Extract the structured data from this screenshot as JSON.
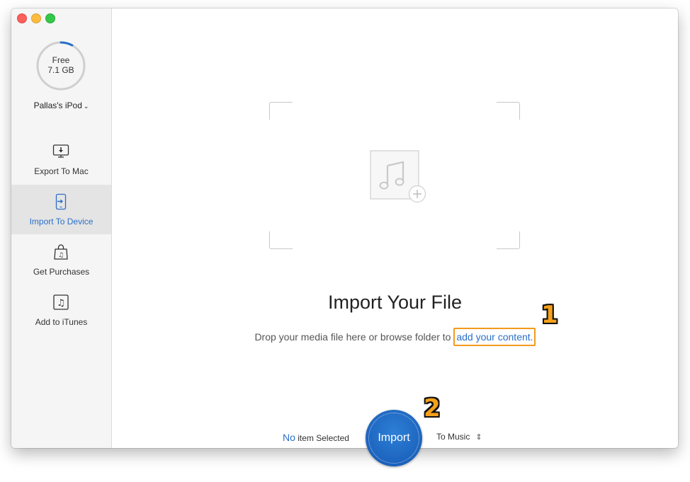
{
  "window": {
    "controls": [
      "close",
      "minimize",
      "maximize"
    ]
  },
  "sidebar": {
    "storage": {
      "label": "Free",
      "value": "7.1 GB",
      "used_fraction": 0.08
    },
    "device_name": "Pallas's iPod",
    "items": [
      {
        "label": "Export To Mac",
        "icon": "monitor-download-icon",
        "active": false
      },
      {
        "label": "Import To Device",
        "icon": "phone-import-icon",
        "active": true
      },
      {
        "label": "Get Purchases",
        "icon": "shopping-bag-icon",
        "active": false
      },
      {
        "label": "Add to iTunes",
        "icon": "music-note-icon",
        "active": false
      }
    ]
  },
  "main": {
    "title": "Import Your File",
    "description_prefix": "Drop your media file here or browse folder to ",
    "description_link": "add your content.",
    "badges": [
      "1",
      "2"
    ],
    "footer": {
      "selected_count": "No",
      "selected_suffix": " item Selected",
      "import_button": "Import",
      "destination": "To Music"
    }
  },
  "colors": {
    "accent": "#2a6fc9",
    "highlight_box": "#f39a1e",
    "badge": "#f5a11a",
    "sidebar_bg": "#f5f5f5",
    "sidebar_active_bg": "#e4e4e4"
  }
}
